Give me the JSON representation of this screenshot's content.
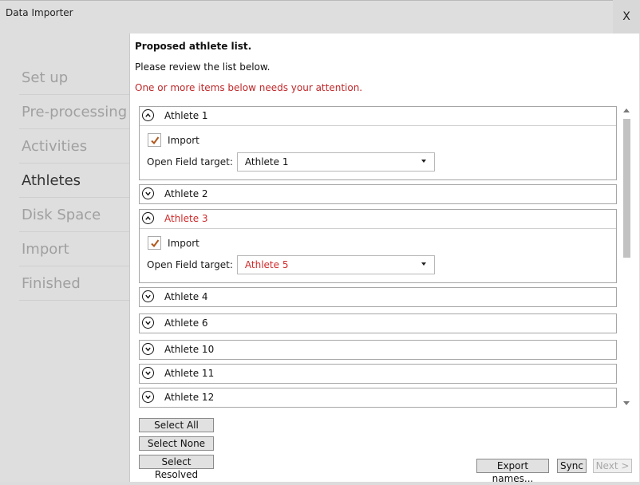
{
  "window": {
    "title": "Data Importer",
    "close_label": "X"
  },
  "nav": {
    "items": [
      {
        "label": "Set up"
      },
      {
        "label": "Pre-processing"
      },
      {
        "label": "Activities"
      },
      {
        "label": "Athletes",
        "active": true
      },
      {
        "label": "Disk Space"
      },
      {
        "label": "Import"
      },
      {
        "label": "Finished"
      }
    ]
  },
  "main": {
    "heading": "Proposed athlete list.",
    "review_text": "Please review the list below.",
    "attention_text": "One or more items below needs your attention.",
    "import_label": "Import",
    "target_label": "Open Field target:",
    "athletes": [
      {
        "label": "Athlete 1",
        "expanded": true,
        "warning": false,
        "import_checked": true,
        "target": "Athlete 1"
      },
      {
        "label": "Athlete 2",
        "expanded": false
      },
      {
        "label": "Athlete 3",
        "expanded": true,
        "warning": true,
        "import_checked": true,
        "target": "Athlete 5"
      },
      {
        "label": "Athlete 4",
        "expanded": false
      },
      {
        "label": "Athlete 6",
        "expanded": false
      },
      {
        "label": "Athlete 10",
        "expanded": false
      },
      {
        "label": "Athlete 11",
        "expanded": false
      },
      {
        "label": "Athlete 12",
        "expanded": false
      }
    ],
    "selection_buttons": {
      "select_all": "Select All",
      "select_none": "Select None",
      "select_resolved": "Select Resolved"
    }
  },
  "footer": {
    "export_label": "Export names...",
    "sync_label": "Sync",
    "next_label": "Next >"
  },
  "colors": {
    "warning": "#d12a2a",
    "check": "#b0561a"
  }
}
